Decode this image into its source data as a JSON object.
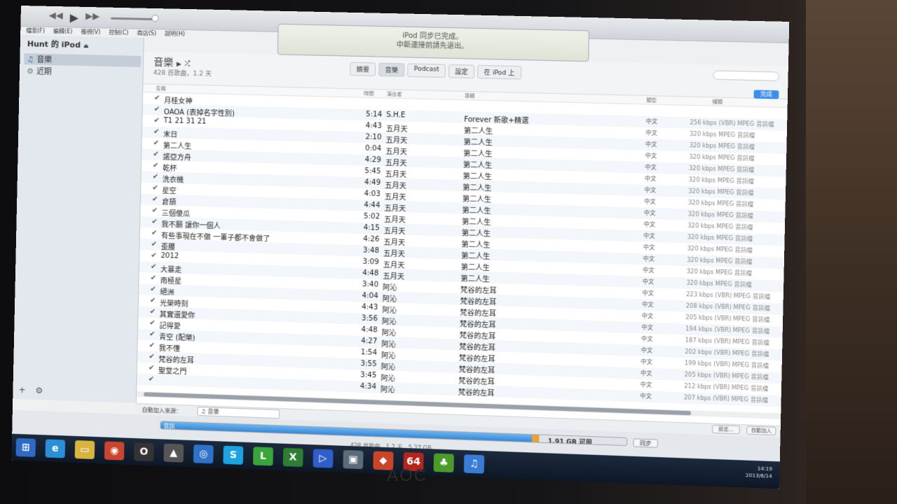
{
  "monitor_brand": "AOC",
  "topbar": {
    "lcd_line1": "iPod 同步已完成。",
    "lcd_line2": "中斷連接前請先退出。"
  },
  "menubar": [
    "檔案(F)",
    "編輯(E)",
    "檢視(V)",
    "控制(C)",
    "商店(S)",
    "說明(H)"
  ],
  "sidebar": {
    "device_title": "Hunt 的 iPod",
    "items": [
      {
        "label": "音樂",
        "icon": "music-note-icon",
        "selected": true
      },
      {
        "label": "近期",
        "icon": "gear-icon",
        "selected": false
      }
    ]
  },
  "main": {
    "title": "音樂",
    "subtitle": "428 首歌曲，1.2 天",
    "tabs": [
      "摘要",
      "音樂",
      "Podcast",
      "設定",
      "在 iPod 上"
    ],
    "done_label": "完成",
    "columns": {
      "name": "名稱",
      "time": "時間",
      "artist": "演出者",
      "album": "專輯",
      "genre": "類型",
      "kind": "種類"
    }
  },
  "songs": [
    {
      "name": "月桂女神",
      "time": "",
      "artist": "",
      "album": "",
      "genre": "",
      "kind": ""
    },
    {
      "name": "OAOA (表掉名字性別)",
      "time": "5:14",
      "artist": "S.H.E",
      "album": "Forever 新歌+精選",
      "genre": "中文",
      "kind": "256 kbps (VBR) MPEG 音訊檔"
    },
    {
      "name": "T1 21 31 21",
      "time": "4:43",
      "artist": "五月天",
      "album": "第二人生",
      "genre": "中文",
      "kind": "320 kbps MPEG 音訊檔"
    },
    {
      "name": "末日",
      "time": "2:10",
      "artist": "五月天",
      "album": "第二人生",
      "genre": "中文",
      "kind": "320 kbps MPEG 音訊檔"
    },
    {
      "name": "第二人生",
      "time": "0:04",
      "artist": "五月天",
      "album": "第二人生",
      "genre": "中文",
      "kind": "320 kbps MPEG 音訊檔"
    },
    {
      "name": "諾亞方舟",
      "time": "4:29",
      "artist": "五月天",
      "album": "第二人生",
      "genre": "中文",
      "kind": "320 kbps MPEG 音訊檔"
    },
    {
      "name": "乾杯",
      "time": "5:45",
      "artist": "五月天",
      "album": "第二人生",
      "genre": "中文",
      "kind": "320 kbps MPEG 音訊檔"
    },
    {
      "name": "洗衣機",
      "time": "4:49",
      "artist": "五月天",
      "album": "第二人生",
      "genre": "中文",
      "kind": "320 kbps MPEG 音訊檔"
    },
    {
      "name": "星空",
      "time": "4:03",
      "artist": "五月天",
      "album": "第二人生",
      "genre": "中文",
      "kind": "320 kbps MPEG 音訊檔"
    },
    {
      "name": "倉頡",
      "time": "4:44",
      "artist": "五月天",
      "album": "第二人生",
      "genre": "中文",
      "kind": "320 kbps MPEG 音訊檔"
    },
    {
      "name": "三個傻瓜",
      "time": "5:02",
      "artist": "五月天",
      "album": "第二人生",
      "genre": "中文",
      "kind": "320 kbps MPEG 音訊檔"
    },
    {
      "name": "我不願 讓你一個人",
      "time": "4:15",
      "artist": "五月天",
      "album": "第二人生",
      "genre": "中文",
      "kind": "320 kbps MPEG 音訊檔"
    },
    {
      "name": "有些事現在不做 一輩子都不會做了",
      "time": "4:26",
      "artist": "五月天",
      "album": "第二人生",
      "genre": "中文",
      "kind": "320 kbps MPEG 音訊檔"
    },
    {
      "name": "歪腰",
      "time": "3:48",
      "artist": "五月天",
      "album": "第二人生",
      "genre": "中文",
      "kind": "320 kbps MPEG 音訊檔"
    },
    {
      "name": "2012",
      "time": "3:09",
      "artist": "五月天",
      "album": "第二人生",
      "genre": "中文",
      "kind": "320 kbps MPEG 音訊檔"
    },
    {
      "name": "大暴走",
      "time": "4:48",
      "artist": "五月天",
      "album": "第二人生",
      "genre": "中文",
      "kind": "320 kbps MPEG 音訊檔"
    },
    {
      "name": "南極星",
      "time": "3:40",
      "artist": "阿沁",
      "album": "梵谷的左耳",
      "genre": "中文",
      "kind": "223 kbps (VBR) MPEG 音訊檔"
    },
    {
      "name": "絕洲",
      "time": "4:04",
      "artist": "阿沁",
      "album": "梵谷的左耳",
      "genre": "中文",
      "kind": "208 kbps (VBR) MPEG 音訊檔"
    },
    {
      "name": "光榮時刻",
      "time": "4:43",
      "artist": "阿沁",
      "album": "梵谷的左耳",
      "genre": "中文",
      "kind": "205 kbps (VBR) MPEG 音訊檔"
    },
    {
      "name": "其實還愛你",
      "time": "3:56",
      "artist": "阿沁",
      "album": "梵谷的左耳",
      "genre": "中文",
      "kind": "194 kbps (VBR) MPEG 音訊檔"
    },
    {
      "name": "記得愛",
      "time": "4:48",
      "artist": "阿沁",
      "album": "梵谷的左耳",
      "genre": "中文",
      "kind": "187 kbps (VBR) MPEG 音訊檔"
    },
    {
      "name": "青空 (配樂)",
      "time": "4:27",
      "artist": "阿沁",
      "album": "梵谷的左耳",
      "genre": "中文",
      "kind": "202 kbps (VBR) MPEG 音訊檔"
    },
    {
      "name": "我不懂",
      "time": "1:54",
      "artist": "阿沁",
      "album": "梵谷的左耳",
      "genre": "中文",
      "kind": "199 kbps (VBR) MPEG 音訊檔"
    },
    {
      "name": "梵谷的左耳",
      "time": "3:55",
      "artist": "阿沁",
      "album": "梵谷的左耳",
      "genre": "中文",
      "kind": "205 kbps (VBR) MPEG 音訊檔"
    },
    {
      "name": "聖堂之門",
      "time": "3:45",
      "artist": "阿沁",
      "album": "梵谷的左耳",
      "genre": "中文",
      "kind": "212 kbps (VBR) MPEG 音訊檔"
    },
    {
      "name": "",
      "time": "4:34",
      "artist": "阿沁",
      "album": "梵谷的左耳",
      "genre": "中文",
      "kind": "207 kbps (VBR) MPEG 音訊檔"
    }
  ],
  "autofill": {
    "label": "自動加入來源：",
    "source": "♫ 音樂"
  },
  "capacity": {
    "label": "音訊",
    "free": "1.91 GB 可用",
    "used_fraction": 0.8,
    "sync_label": "同步",
    "settings_label": "設定...",
    "autofill_label": "自動加入"
  },
  "status": "428 首歌曲，1.2 天，5.27 GB",
  "taskbar": {
    "icons": [
      "windows-start-icon",
      "ie-icon",
      "folder-icon",
      "chrome-icon",
      "opera-icon",
      "fox-icon",
      "network-icon",
      "skype-icon",
      "line-icon",
      "excel-icon",
      "media-icon",
      "app-icon",
      "game-icon",
      "cpu-z-icon",
      "evernote-icon",
      "itunes-icon"
    ],
    "time": "14:19",
    "date": "2013/6/14"
  },
  "colors": {
    "accent": "#2f7fd0",
    "taskbar": "#0d1726",
    "orange": "#e8a13a"
  }
}
